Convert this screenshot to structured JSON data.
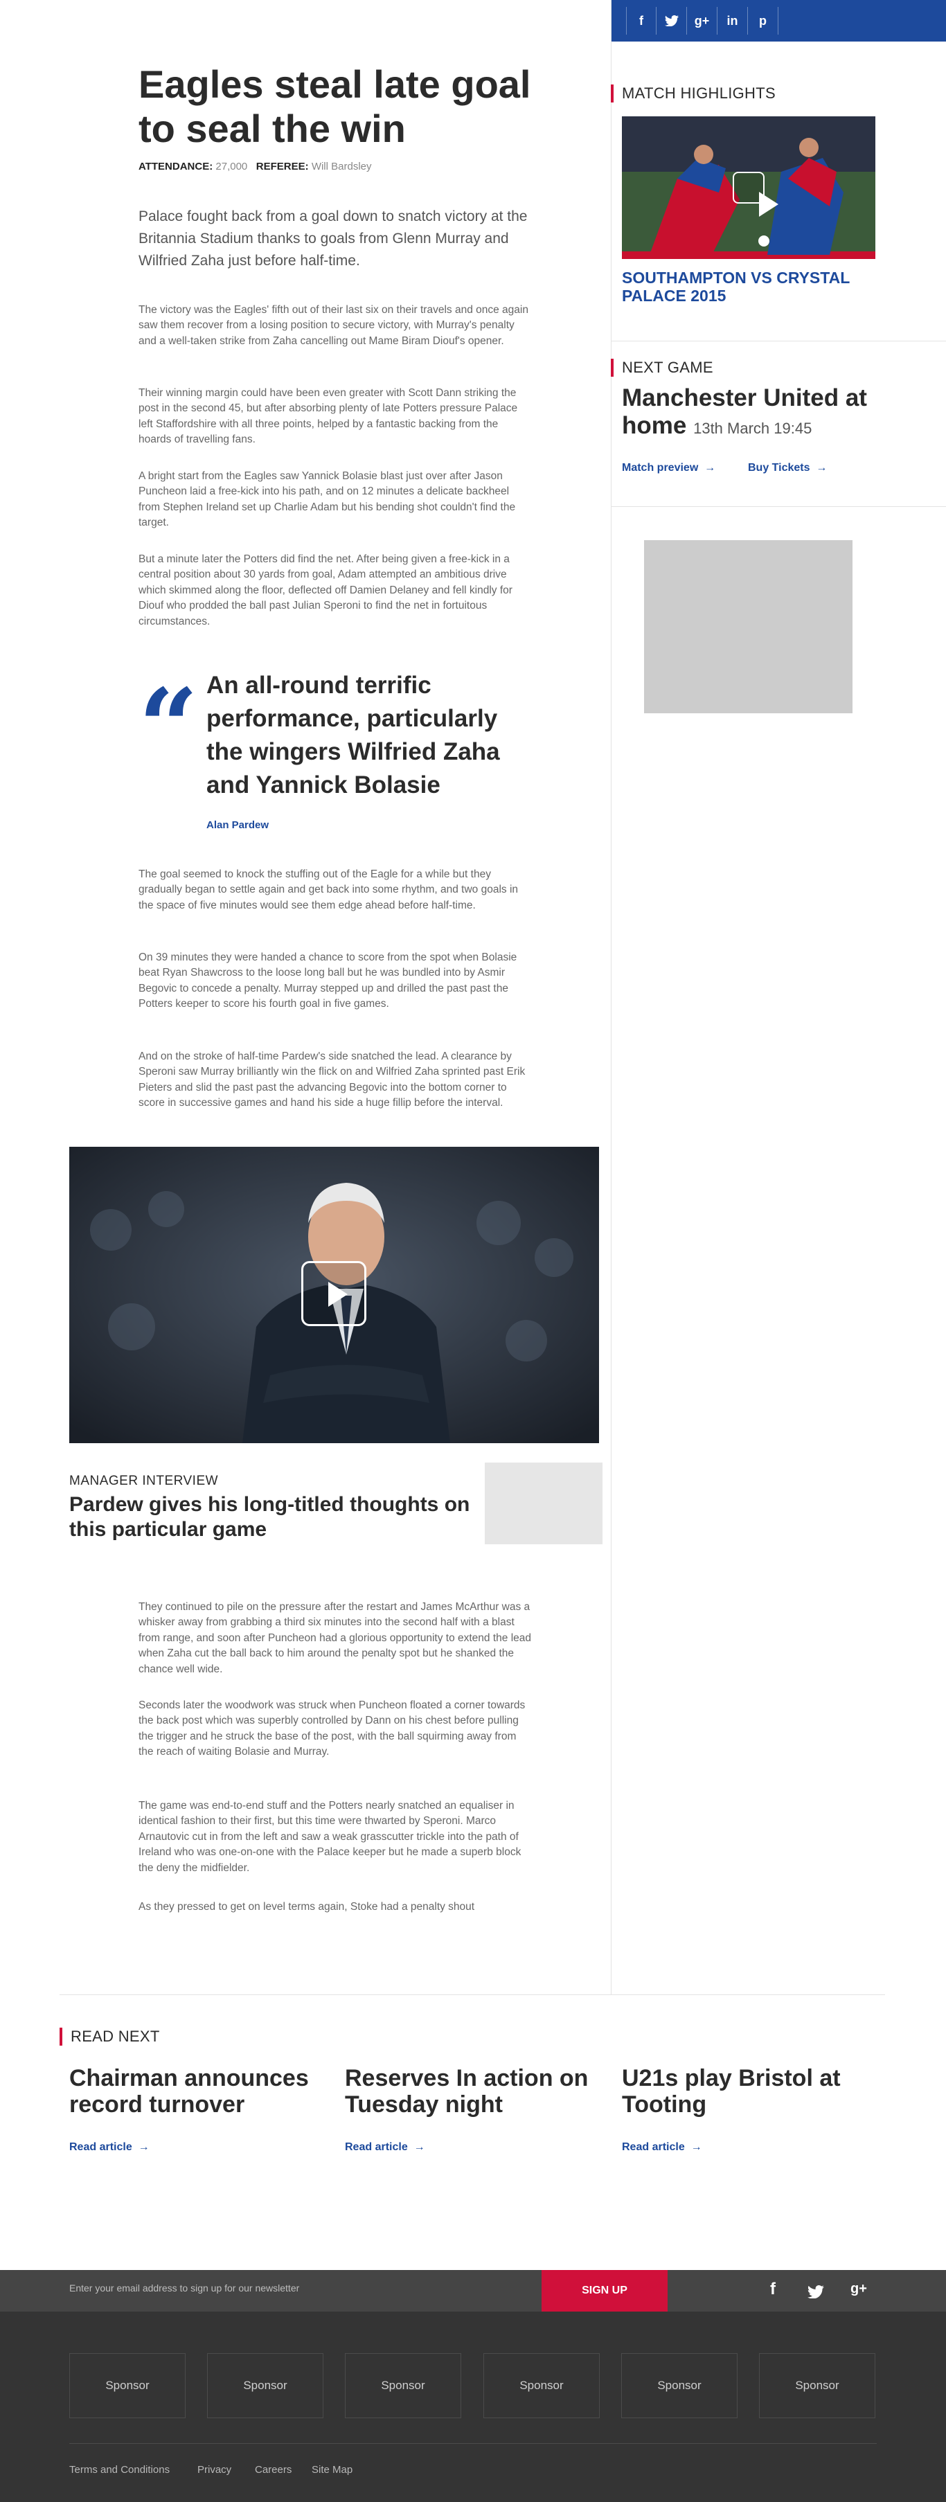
{
  "social_bar": {
    "icons": [
      "facebook-icon",
      "twitter-icon",
      "google-plus-icon",
      "linkedin-icon",
      "pinterest-icon"
    ],
    "glyphs": [
      "f",
      "t",
      "g+",
      "in",
      "p"
    ]
  },
  "article": {
    "headline": "Eagles steal late goal to seal the win",
    "attendance_label": "ATTENDANCE:",
    "attendance_value": "27,000",
    "referee_label": "REFEREE:",
    "referee_value": "Will Bardsley",
    "intro": "Palace fought back from a goal down to snatch victory at the Britannia Stadium thanks to goals from Glenn Murray and Wilfried Zaha just before half-time.",
    "paragraphs": [
      "The victory was the Eagles' fifth out of their last six on their travels and once again saw them recover from a losing position to secure victory, with Murray's penalty and a well-taken strike from Zaha cancelling out Mame Biram Diouf's opener.",
      "Their winning margin could have been even greater with Scott Dann striking the post in the second 45, but after absorbing plenty of late Potters pressure Palace left Staffordshire with all three points, helped by a fantastic backing from the hoards of travelling fans.",
      "A bright start from the Eagles saw Yannick Bolasie blast just over after Jason Puncheon laid a free-kick into his path, and on 12 minutes a delicate backheel from Stephen Ireland set up Charlie Adam but his bending shot couldn't find the target.",
      "But a minute later the Potters did find the net. After being given a free-kick in a central position about 30 yards from goal, Adam attempted an ambitious drive which skimmed along the floor, deflected off Damien Delaney and fell kindly for Diouf who prodded the ball past Julian Speroni to find the net in fortuitous circumstances.",
      "The goal seemed to knock the stuffing out of the Eagle for a while but they gradually began to settle again and get back into some rhythm, and two goals in the space of five minutes would see them edge ahead before half-time.",
      "On 39 minutes they were handed a chance to score from the spot when Bolasie beat Ryan Shawcross to the loose long ball but he was bundled into by Asmir Begovic to concede a penalty. Murray stepped up and drilled the past past the Potters keeper to score his fourth goal in five games.",
      "And on the stroke of half-time Pardew's side snatched the lead. A clearance by Speroni saw Murray brilliantly win the flick on and Wilfried Zaha sprinted past Erik Pieters and slid the past past the advancing Begovic into the bottom corner to score in successive games and hand his side a huge fillip before the interval.",
      "They continued to pile on the pressure after the restart and James McArthur was a whisker away from grabbing a third six minutes into the second half with a blast from range, and soon after Puncheon had a glorious opportunity to extend the lead when Zaha cut the ball back to him around the penalty spot but he shanked the chance well wide.",
      "Seconds later the woodwork was struck when Puncheon floated a corner towards the back post which was superbly controlled by Dann on his chest before pulling the trigger and he struck the base of the post, with the ball squirming away from the reach of waiting Bolasie and Murray.",
      "The game was end-to-end stuff and the Potters nearly snatched an equaliser in identical fashion to their first, but this time were thwarted by Speroni. Marco Arnautovic cut in from the left and saw a weak grasscutter trickle into the path of Ireland who was one-on-one with the Palace keeper but he made a superb block the deny the midfielder.",
      "As they pressed to get on level terms again, Stoke had a penalty shout"
    ],
    "quote": {
      "mark": "“",
      "text": "An all-round terrific performance, particularly the wingers Wilfried Zaha and Yannick Bolasie",
      "author": "Alan Pardew"
    },
    "video": {
      "play_icon": "play-icon"
    },
    "interview": {
      "label": "MANAGER INTERVIEW",
      "title": "Pardew gives his long-titled thoughts on this particular game"
    }
  },
  "sidebar": {
    "highlights_label": "MATCH HIGHLIGHTS",
    "highlights_title": "SOUTHAMPTON VS CRYSTAL PALACE 2015",
    "next_game_label": "NEXT GAME",
    "next_game_team": "Manchester United at home",
    "next_game_date": "13th March 19:45",
    "match_preview": "Match preview",
    "buy_tickets": "Buy Tickets"
  },
  "read_next": {
    "label": "READ NEXT",
    "items": [
      {
        "title": "Chairman announces record turnover",
        "link": "Read article"
      },
      {
        "title": "Reserves In action on Tuesday night",
        "link": "Read article"
      },
      {
        "title": "U21s play Bristol at Tooting",
        "link": "Read article"
      }
    ]
  },
  "footer": {
    "newsletter_placeholder": "Enter your email address to sign up for our newsletter",
    "signup_label": "SIGN UP",
    "social_icons": [
      "facebook-icon",
      "twitter-icon",
      "google-plus-icon"
    ],
    "social_glyphs": [
      "f",
      "t",
      "g+"
    ],
    "sponsors": [
      "Sponsor",
      "Sponsor",
      "Sponsor",
      "Sponsor",
      "Sponsor",
      "Sponsor"
    ],
    "links": [
      "Terms and Conditions",
      "Privacy",
      "Careers",
      "Site Map"
    ]
  },
  "colors": {
    "brand_blue": "#1d4a9c",
    "accent_red": "#d0103a",
    "footer_dark": "#343434"
  }
}
